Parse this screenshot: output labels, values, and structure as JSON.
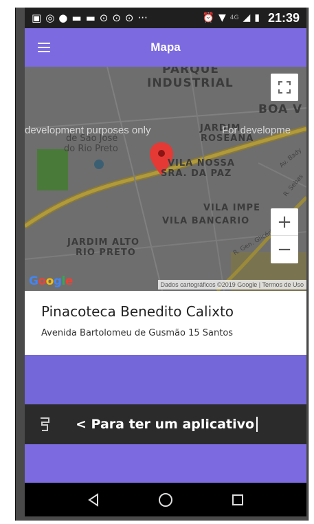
{
  "status_bar": {
    "notification_icons": [
      "gallery-icon",
      "whatsapp-icon",
      "pinterest-icon",
      "youtube-icon",
      "youtube-icon",
      "pinterest-icon",
      "pinterest-icon",
      "pinterest-icon"
    ],
    "more_indicator": "···",
    "network": "4G",
    "time": "21:39"
  },
  "app_bar": {
    "title": "Mapa",
    "menu_icon": "hamburger-icon",
    "background": "#7b6ae0"
  },
  "map": {
    "labels": {
      "parque_industrial_1": "PARQUE",
      "parque_industrial_2": "INDUSTRIAL",
      "boa_vista": "BOA V",
      "jardim_roseana_1": "JARDIM",
      "jardim_roseana_2": "ROSEANA",
      "sao_jose_1": "de São José",
      "sao_jose_2": "do Rio Preto",
      "vila_nossa_1": "VILA NOSSA",
      "vila_nossa_2": "SRA. DA PAZ",
      "vila_imperial": "VILA IMPE",
      "vila_bancario": "VILA BANCARIO",
      "jardim_alto_1": "JARDIM ALTO",
      "jardim_alto_2": "RIO PRETO",
      "av_bady": "Av. Bady",
      "r_sebas": "R. Sebas",
      "r_gen_glicerio": "R. Gen. Glicério"
    },
    "watermark_left": "development purposes only",
    "watermark_right": "For developme",
    "google_logo": "Google",
    "attribution": "Dados cartográficos ©2019 Google",
    "terms": "Termos de Uso",
    "zoom_in": "+",
    "zoom_out": "−"
  },
  "place": {
    "name": "Pinacoteca Benedito Calixto",
    "address": "Avenida Bartolomeu de Gusmão 15 Santos"
  },
  "input_bar": {
    "text": "< Para ter um aplicativo"
  },
  "nav_bar": {
    "back_icon": "back-triangle-icon",
    "home_icon": "home-circle-icon",
    "recents_icon": "recents-square-icon"
  },
  "colors": {
    "primary": "#7b6ae0",
    "purple_band": "#7467d9",
    "pin": "#e53935"
  }
}
